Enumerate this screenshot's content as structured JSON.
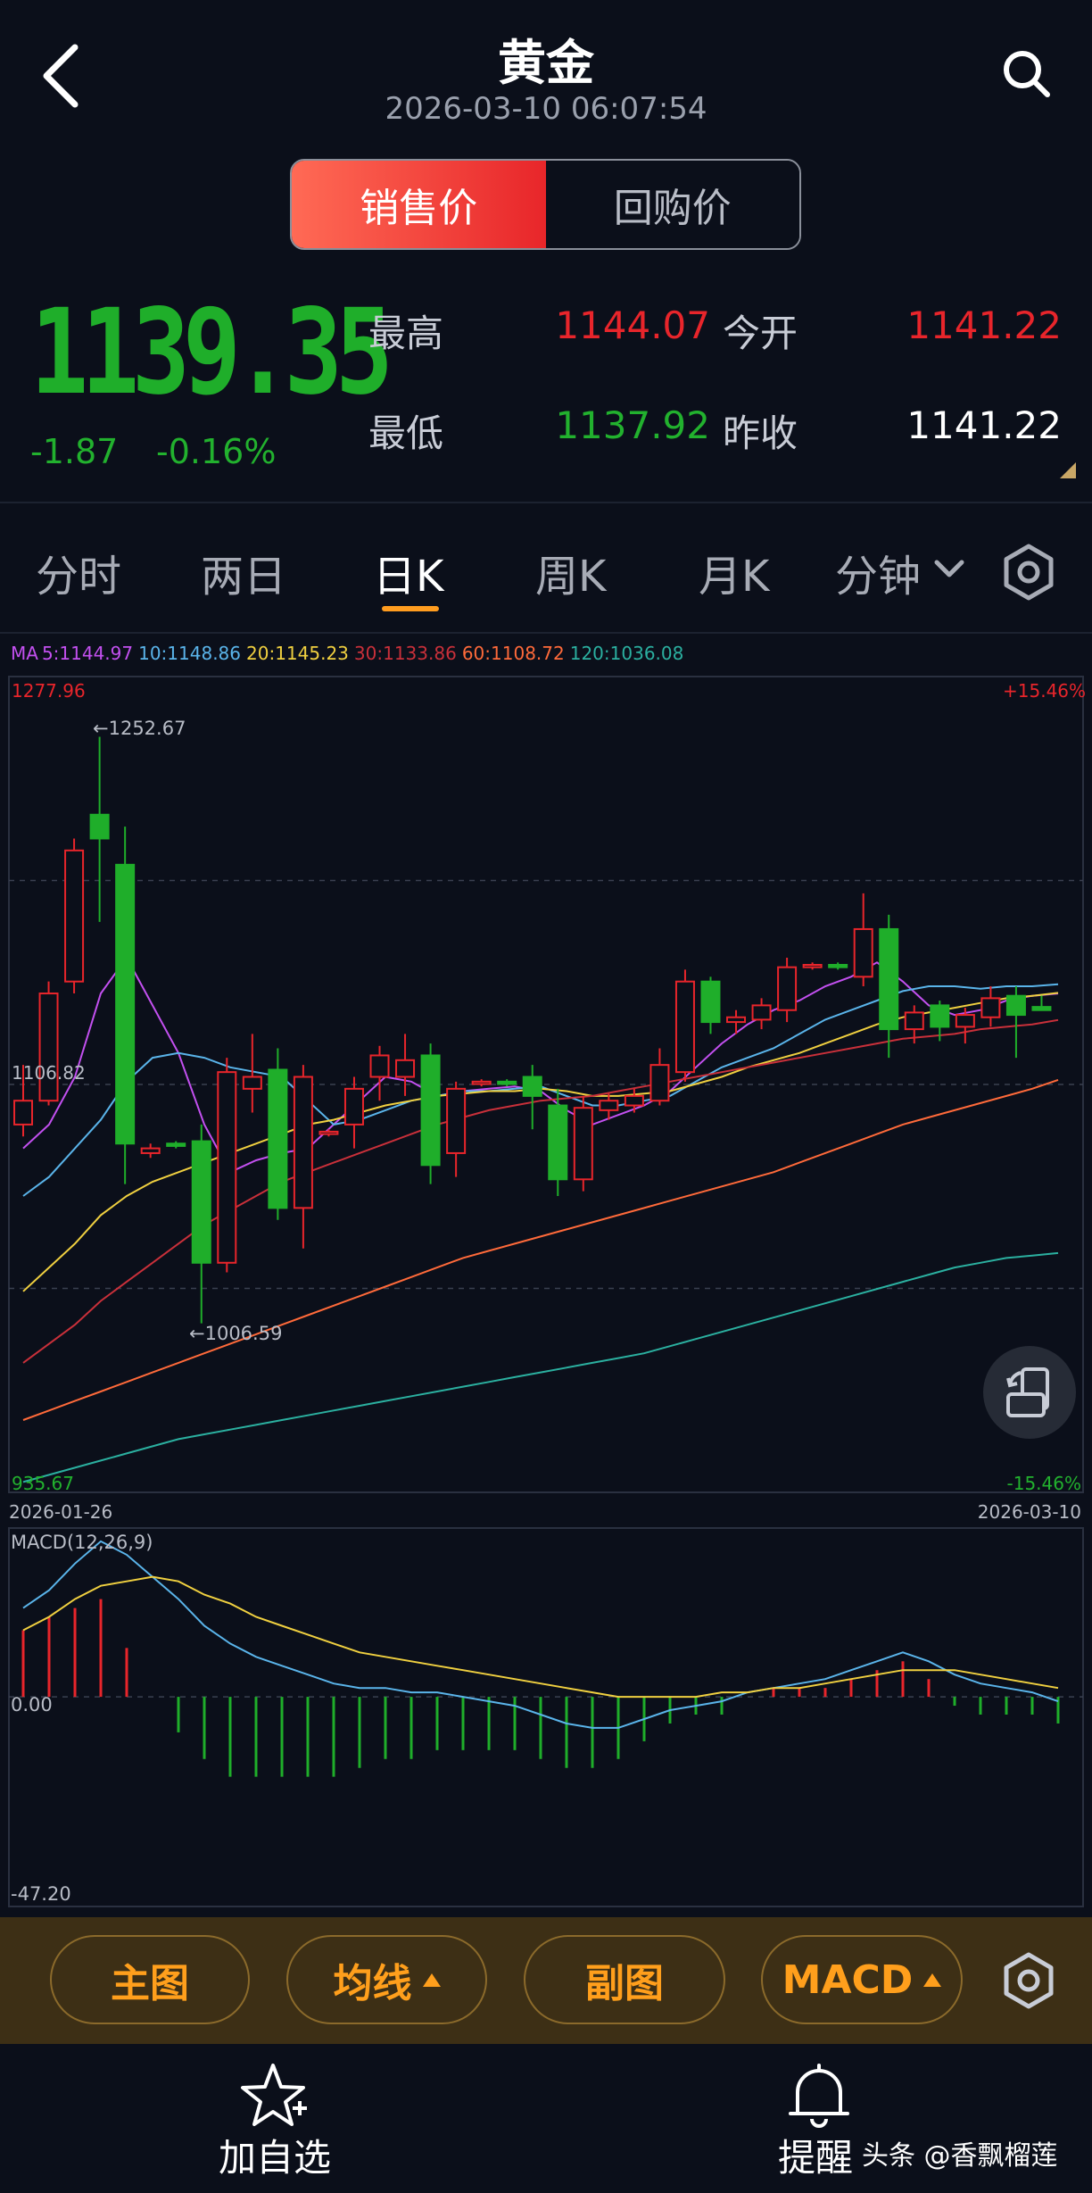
{
  "header": {
    "title": "黄金",
    "datetime": "2026-03-10 06:07:54"
  },
  "price_type": {
    "options": [
      "销售价",
      "回购价"
    ],
    "selected": "销售价"
  },
  "quote": {
    "price": "1139.35",
    "change": "-1.87",
    "change_pct": "-0.16%",
    "high_label": "最高",
    "high": "1144.07",
    "open_label": "今开",
    "open": "1141.22",
    "low_label": "最低",
    "low": "1137.92",
    "prev_close_label": "昨收",
    "prev_close": "1141.22"
  },
  "period_tabs": {
    "items": [
      "分时",
      "两日",
      "日K",
      "周K",
      "月K",
      "分钟"
    ],
    "selected": "日K"
  },
  "colors": {
    "up": "#e8252b",
    "down": "#1fae2a",
    "accent": "#ff9f1c",
    "ma5": "#c350f0",
    "ma10": "#5ab4ea",
    "ma20": "#f0d040",
    "ma30": "#c9303a",
    "ma60": "#ff6a3a",
    "ma120": "#2bb0a0"
  },
  "ma_legend": {
    "prefix": "MA",
    "ma5": "5:1144.97",
    "ma10": "10:1148.86",
    "ma20": "20:1145.23",
    "ma30": "30:1133.86",
    "ma60": "60:1108.72",
    "ma120": "120:1036.08"
  },
  "axis": {
    "price_max": "1277.96",
    "price_mid": "1106.82",
    "price_min": "935.67",
    "pct_max": "+15.46%",
    "pct_min": "-15.46%",
    "date_start": "2026-01-26",
    "date_end": "2026-03-10",
    "period_high": "←1252.67",
    "period_low": "←1006.59"
  },
  "chart_data": {
    "type": "candlestick",
    "ylim": [
      935.67,
      1277.96
    ],
    "x_range": [
      "2026-01-26",
      "2026-03-10"
    ],
    "candles": [
      {
        "o": 1090,
        "c": 1100,
        "h": 1115,
        "l": 1085
      },
      {
        "o": 1100,
        "c": 1145,
        "h": 1150,
        "l": 1098
      },
      {
        "o": 1150,
        "c": 1205,
        "h": 1210,
        "l": 1145
      },
      {
        "o": 1220,
        "c": 1210,
        "h": 1252.67,
        "l": 1175
      },
      {
        "o": 1199,
        "c": 1082,
        "h": 1215,
        "l": 1065
      },
      {
        "o": 1078,
        "c": 1080,
        "h": 1082,
        "l": 1076
      },
      {
        "o": 1082,
        "c": 1081,
        "h": 1083,
        "l": 1080
      },
      {
        "o": 1083,
        "c": 1032,
        "h": 1090,
        "l": 1006.59
      },
      {
        "o": 1032,
        "c": 1112,
        "h": 1118,
        "l": 1028
      },
      {
        "o": 1105,
        "c": 1110,
        "h": 1128,
        "l": 1095
      },
      {
        "o": 1113,
        "c": 1055,
        "h": 1122,
        "l": 1050
      },
      {
        "o": 1055,
        "c": 1110,
        "h": 1115,
        "l": 1038
      },
      {
        "o": 1086,
        "c": 1087,
        "h": 1088,
        "l": 1085
      },
      {
        "o": 1090,
        "c": 1105,
        "h": 1110,
        "l": 1080
      },
      {
        "o": 1110,
        "c": 1119,
        "h": 1123,
        "l": 1100
      },
      {
        "o": 1110,
        "c": 1117,
        "h": 1128,
        "l": 1102
      },
      {
        "o": 1119,
        "c": 1073,
        "h": 1124,
        "l": 1065
      },
      {
        "o": 1078,
        "c": 1105,
        "h": 1108,
        "l": 1068
      },
      {
        "o": 1107,
        "c": 1108,
        "h": 1109,
        "l": 1106
      },
      {
        "o": 1108,
        "c": 1107,
        "h": 1109,
        "l": 1106
      },
      {
        "o": 1110,
        "c": 1102,
        "h": 1115,
        "l": 1088
      },
      {
        "o": 1098,
        "c": 1067,
        "h": 1105,
        "l": 1060
      },
      {
        "o": 1067,
        "c": 1097,
        "h": 1102,
        "l": 1062
      },
      {
        "o": 1096,
        "c": 1100,
        "h": 1103,
        "l": 1092
      },
      {
        "o": 1098,
        "c": 1102,
        "h": 1105,
        "l": 1095
      },
      {
        "o": 1100,
        "c": 1115,
        "h": 1122,
        "l": 1098
      },
      {
        "o": 1112,
        "c": 1150,
        "h": 1155,
        "l": 1108
      },
      {
        "o": 1150,
        "c": 1133,
        "h": 1152,
        "l": 1128
      },
      {
        "o": 1133,
        "c": 1135,
        "h": 1138,
        "l": 1128
      },
      {
        "o": 1134,
        "c": 1140,
        "h": 1143,
        "l": 1130
      },
      {
        "o": 1138,
        "c": 1156,
        "h": 1160,
        "l": 1133
      },
      {
        "o": 1156,
        "c": 1157,
        "h": 1158,
        "l": 1155
      },
      {
        "o": 1157,
        "c": 1156,
        "h": 1158,
        "l": 1155
      },
      {
        "o": 1152,
        "c": 1172,
        "h": 1187,
        "l": 1148
      },
      {
        "o": 1172,
        "c": 1130,
        "h": 1178,
        "l": 1118
      },
      {
        "o": 1130,
        "c": 1137,
        "h": 1140,
        "l": 1124
      },
      {
        "o": 1140,
        "c": 1131,
        "h": 1142,
        "l": 1125
      },
      {
        "o": 1131,
        "c": 1136,
        "h": 1139,
        "l": 1124
      },
      {
        "o": 1135,
        "c": 1143,
        "h": 1148,
        "l": 1131
      },
      {
        "o": 1144,
        "c": 1136,
        "h": 1148,
        "l": 1118
      },
      {
        "o": 1139.35,
        "c": 1138,
        "h": 1144.07,
        "l": 1137.92
      }
    ],
    "ma_series": [
      {
        "name": "MA5",
        "values": [
          1080,
          1090,
          1110,
          1145,
          1160,
          1140,
          1120,
          1090,
          1070,
          1075,
          1078,
          1080,
          1090,
          1100,
          1110,
          1108,
          1102,
          1104,
          1105,
          1106,
          1104,
          1096,
          1090,
          1094,
          1098,
          1104,
          1114,
          1124,
          1132,
          1138,
          1142,
          1148,
          1152,
          1158,
          1150,
          1140,
          1136,
          1138,
          1142,
          1144,
          1144.97
        ]
      },
      {
        "name": "MA10",
        "values": [
          1060,
          1068,
          1080,
          1092,
          1108,
          1118,
          1120,
          1118,
          1114,
          1112,
          1110,
          1100,
          1090,
          1092,
          1096,
          1100,
          1102,
          1104,
          1104,
          1105,
          1106,
          1102,
          1098,
          1098,
          1100,
          1102,
          1108,
          1114,
          1118,
          1122,
          1128,
          1134,
          1138,
          1142,
          1146,
          1148,
          1148,
          1147,
          1148,
          1148,
          1148.86
        ]
      },
      {
        "name": "MA20",
        "values": [
          1020,
          1030,
          1040,
          1052,
          1060,
          1066,
          1070,
          1074,
          1078,
          1082,
          1086,
          1090,
          1092,
          1095,
          1098,
          1100,
          1102,
          1103,
          1104,
          1104,
          1105,
          1104,
          1102,
          1102,
          1103,
          1104,
          1107,
          1110,
          1114,
          1117,
          1120,
          1124,
          1128,
          1132,
          1135,
          1137,
          1139,
          1141,
          1143,
          1144,
          1145.23
        ]
      },
      {
        "name": "MA30",
        "values": [
          990,
          998,
          1006,
          1016,
          1024,
          1032,
          1040,
          1048,
          1054,
          1060,
          1066,
          1070,
          1074,
          1078,
          1082,
          1086,
          1090,
          1093,
          1096,
          1098,
          1100,
          1101,
          1102,
          1104,
          1106,
          1108,
          1110,
          1112,
          1114,
          1116,
          1118,
          1120,
          1122,
          1124,
          1126,
          1127,
          1128,
          1130,
          1131,
          1132,
          1133.86
        ]
      },
      {
        "name": "MA60",
        "values": [
          966,
          970,
          974,
          978,
          982,
          986,
          990,
          994,
          998,
          1002,
          1006,
          1010,
          1014,
          1018,
          1022,
          1026,
          1030,
          1034,
          1037,
          1040,
          1043,
          1046,
          1049,
          1052,
          1055,
          1058,
          1061,
          1064,
          1067,
          1070,
          1074,
          1078,
          1082,
          1086,
          1090,
          1093,
          1096,
          1099,
          1102,
          1105,
          1108.72
        ]
      },
      {
        "name": "MA120",
        "values": [
          940,
          943,
          946,
          949,
          952,
          955,
          958,
          960,
          962,
          964,
          966,
          968,
          970,
          972,
          974,
          976,
          978,
          980,
          982,
          984,
          986,
          988,
          990,
          992,
          994,
          997,
          1000,
          1003,
          1006,
          1009,
          1012,
          1015,
          1018,
          1021,
          1024,
          1027,
          1030,
          1032,
          1034,
          1035,
          1036.08
        ]
      }
    ],
    "macd": {
      "title": "MACD(12,26,9)",
      "zero_label": "0.00",
      "min_label": "-47.20",
      "ylim": [
        -47.2,
        38
      ],
      "dif": [
        20,
        24,
        30,
        35,
        32,
        27,
        22,
        16,
        12,
        9,
        7,
        5,
        3,
        2,
        2,
        1,
        1,
        0,
        -1,
        -2,
        -4,
        -6,
        -7,
        -7,
        -5,
        -3,
        -2,
        -1,
        1,
        2,
        3,
        4,
        6,
        8,
        10,
        8,
        5,
        3,
        2,
        1,
        -1
      ],
      "dea": [
        15,
        18,
        22,
        25,
        26,
        27,
        26,
        23,
        21,
        18,
        16,
        14,
        12,
        10,
        9,
        8,
        7,
        6,
        5,
        4,
        3,
        2,
        1,
        0,
        0,
        0,
        0,
        1,
        1,
        2,
        2,
        3,
        4,
        5,
        6,
        6,
        6,
        5,
        4,
        3,
        2
      ],
      "hist": [
        15,
        18,
        20,
        22,
        11,
        0,
        -8,
        -14,
        -18,
        -18,
        -18,
        -18,
        -18,
        -16,
        -14,
        -14,
        -12,
        -12,
        -12,
        -12,
        -14,
        -16,
        -16,
        -14,
        -10,
        -6,
        -4,
        -4,
        0,
        2,
        2,
        2,
        4,
        6,
        8,
        4,
        -2,
        -4,
        -4,
        -4,
        -6
      ]
    }
  },
  "toolbar": {
    "main_chart": "主图",
    "ma": "均线",
    "sub_chart": "副图",
    "macd": "MACD"
  },
  "nav": {
    "watchlist": "加自选",
    "alert": "提醒"
  },
  "watermark": "头条 @香飘榴莲"
}
